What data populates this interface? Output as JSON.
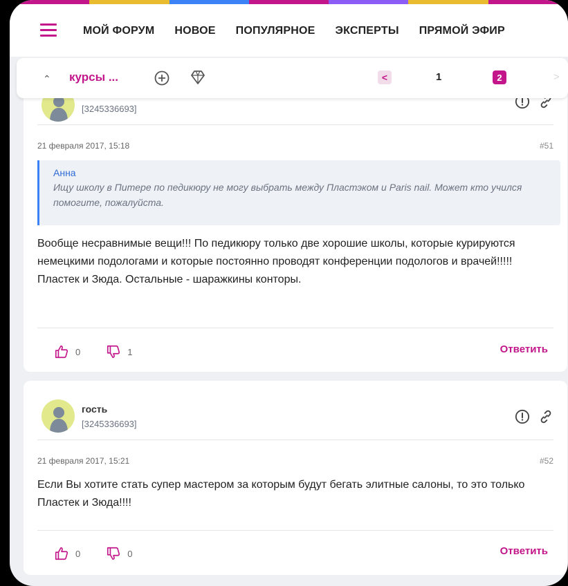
{
  "colors": {
    "accent": "#c2168a",
    "quote_border": "#3b82f6",
    "avatar_bg": "#e2e98c",
    "topline": [
      "#c2168a",
      "#e9bb2e",
      "#3b82f6",
      "#c2168a",
      "#8b5cf6",
      "#e9bb2e",
      "#c2168a"
    ]
  },
  "nav": {
    "items": [
      "МОЙ ФОРУМ",
      "НОВОЕ",
      "ПОПУЛЯРНОЕ",
      "ЭКСПЕРТЫ",
      "ПРЯМОЙ ЭФИР"
    ]
  },
  "topic": {
    "title": "курсы ...",
    "pagination": {
      "prev": "<",
      "page1": "1",
      "page2": "2",
      "next": ">"
    }
  },
  "posts": [
    {
      "uid": "[3245336693]",
      "date": "21 февраля 2017, 15:18",
      "number": "#51",
      "quote": {
        "author": "Анна",
        "text": "Ищу школу в Питере по педикюру не могу выбрать между Пластэком и Paris nail. Может кто учился помогите, пожалуйста."
      },
      "text": "Вообще несравнимые вещи!!! По педикюру только две хорошие школы, которые курируются немецкими подологами и которые постоянно проводят конференции подологов и врачей!!!!! Пластек и Зюда. Остальные - шаражкины конторы.",
      "likes": "0",
      "dislikes": "1",
      "reply": "Ответить"
    },
    {
      "author": "гость",
      "uid": "[3245336693]",
      "date": "21 февраля 2017, 15:21",
      "number": "#52",
      "text": "Если Вы хотите стать супер мастером за которым будут бегать элитные салоны, то это только Пластек и Зюда!!!!",
      "likes": "0",
      "dislikes": "0",
      "reply": "Ответить"
    }
  ]
}
